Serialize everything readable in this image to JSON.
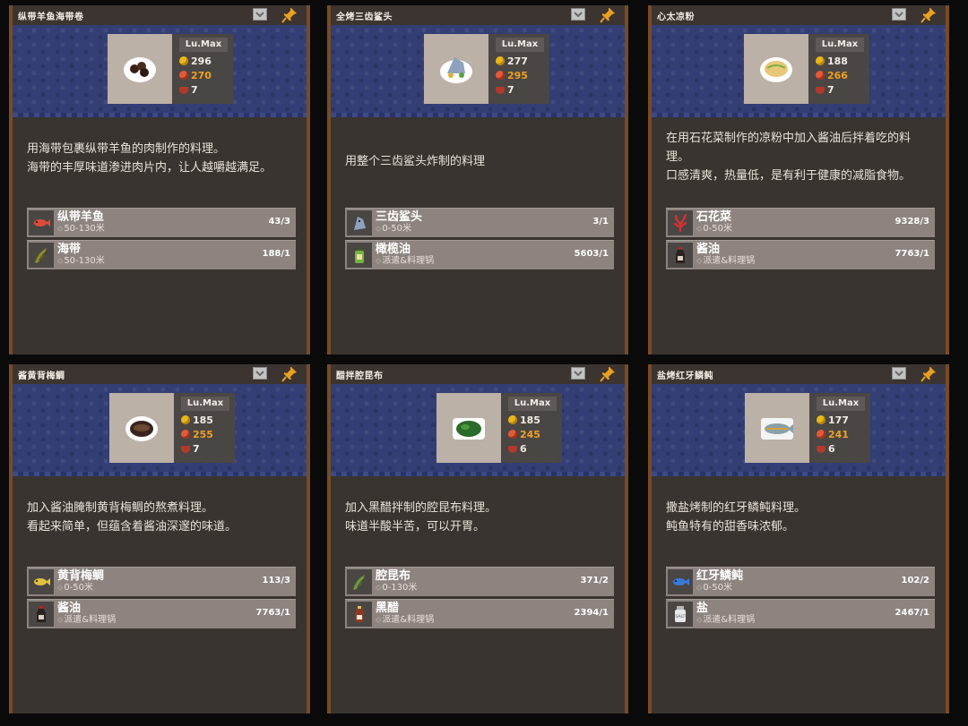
{
  "panels": [
    {
      "title": "纵带羊鱼海带卷",
      "level": "Lu.Max",
      "price": "296",
      "taste": "270",
      "servings": "7",
      "desc": [
        "用海带包裹纵带羊鱼的肉制作的料理。",
        "海带的丰厚味道渗进肉片内，让人越嚼越满足。"
      ],
      "ingredients": [
        {
          "name": "纵带羊鱼",
          "loc": "50-130米",
          "count": "43/3",
          "icon": "fish-icon",
          "color": "#e04a3a"
        },
        {
          "name": "海带",
          "loc": "50-130米",
          "count": "188/1",
          "icon": "kelp-icon",
          "color": "#8a8a2a"
        }
      ]
    },
    {
      "title": "全烤三齿鲨头",
      "level": "Lu.Max",
      "price": "277",
      "taste": "295",
      "servings": "7",
      "desc": [
        "用整个三齿鲨头炸制的料理"
      ],
      "ingredients": [
        {
          "name": "三齿鲨头",
          "loc": "0-50米",
          "count": "3/1",
          "icon": "shark-head-icon",
          "color": "#8ea2c0"
        },
        {
          "name": "橄榄油",
          "loc": "派遣&料理锅",
          "count": "5603/1",
          "icon": "olive-oil-icon",
          "color": "#7ab040"
        }
      ]
    },
    {
      "title": "心太凉粉",
      "level": "Lu.Max",
      "price": "188",
      "taste": "266",
      "servings": "7",
      "desc": [
        "在用石花菜制作的凉粉中加入酱油后拌着吃的料",
        "理。",
        "口感清爽，热量低，是有利于健康的减脂食物。"
      ],
      "ingredients": [
        {
          "name": "石花菜",
          "loc": "0-50米",
          "count": "9328/3",
          "icon": "seaweed-icon",
          "color": "#d83030"
        },
        {
          "name": "酱油",
          "loc": "派遣&料理锅",
          "count": "7763/1",
          "icon": "soy-sauce-icon",
          "color": "#2a2220"
        }
      ]
    },
    {
      "title": "酱黄背梅鲷",
      "level": "Lu.Max",
      "price": "185",
      "taste": "255",
      "servings": "7",
      "desc": [
        "加入酱油腌制黄背梅鲷的熬煮料理。",
        "看起来简单，但蕴含着酱油深邃的味道。"
      ],
      "ingredients": [
        {
          "name": "黄背梅鲷",
          "loc": "0-50米",
          "count": "113/3",
          "icon": "fish-icon",
          "color": "#e0c040"
        },
        {
          "name": "酱油",
          "loc": "派遣&料理锅",
          "count": "7763/1",
          "icon": "soy-sauce-icon",
          "color": "#2a2220"
        }
      ]
    },
    {
      "title": "醋拌腔昆布",
      "level": "Lu.Max",
      "price": "185",
      "taste": "245",
      "servings": "6",
      "desc": [
        "加入黑醋拌制的腔昆布料理。",
        "味道半酸半苦，可以开胃。"
      ],
      "ingredients": [
        {
          "name": "腔昆布",
          "loc": "0-130米",
          "count": "371/2",
          "icon": "kelp-icon",
          "color": "#6a9a3a"
        },
        {
          "name": "黑醋",
          "loc": "派遣&料理锅",
          "count": "2394/1",
          "icon": "vinegar-icon",
          "color": "#8a3a20"
        }
      ]
    },
    {
      "title": "盐烤红牙鳞鲀",
      "level": "Lu.Max",
      "price": "177",
      "taste": "241",
      "servings": "6",
      "desc": [
        "撒盐烤制的红牙鳞鲀料理。",
        "鲀鱼特有的甜香味浓郁。"
      ],
      "ingredients": [
        {
          "name": "红牙鳞鲀",
          "loc": "0-50米",
          "count": "102/2",
          "icon": "fish-icon",
          "color": "#3a7ad8"
        },
        {
          "name": "盐",
          "loc": "派遣&料理锅",
          "count": "2467/1",
          "icon": "salt-icon",
          "color": "#e8e8e8"
        }
      ]
    }
  ],
  "ui": {
    "salt_label": "SALT"
  }
}
